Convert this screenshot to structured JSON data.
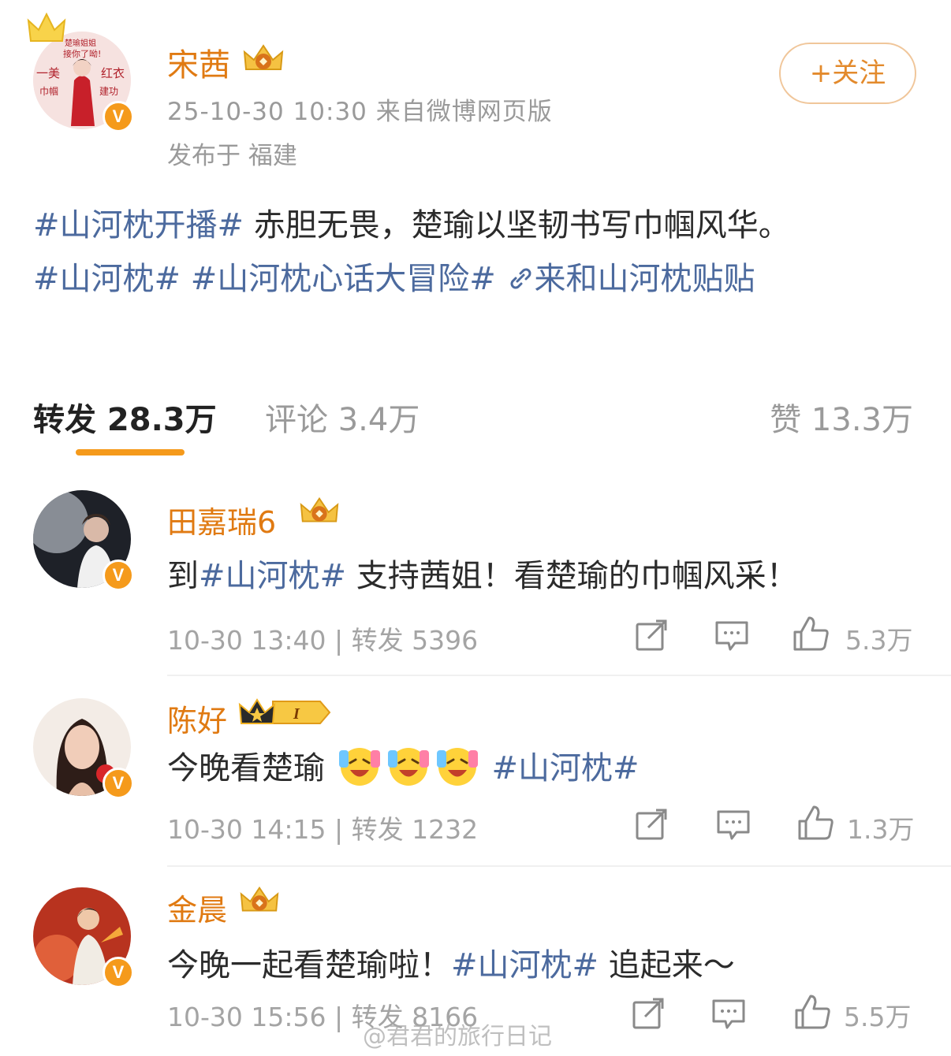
{
  "post": {
    "author": "宋茜",
    "meta": "25-10-30 10:30  来自微博网页版",
    "location": "发布于 福建",
    "follow_label": "+关注",
    "body_tag1": "#山河枕开播#",
    "body_text1": " 赤胆无畏，楚瑜以坚韧书写巾帼风华。",
    "body_tag2": "#山河枕#",
    "body_tag3": "#山河枕心话大冒险#",
    "body_link": "来和山河枕贴贴",
    "avatar_text": [
      "楚瑜姐姐",
      "接你了呦!",
      "一美",
      "红衣",
      "巾帼",
      "建功"
    ]
  },
  "tabs": {
    "repost": "转发 28.3万",
    "comment": "评论 3.4万",
    "like": "赞 13.3万"
  },
  "reposts": [
    {
      "name": "田嘉瑞6",
      "text_pre": "到",
      "tag": "#山河枕#",
      "text_post": " 支持茜姐！看楚瑜的巾帼风采！",
      "time": "10-30 13:40",
      "repost_count": "转发 5396",
      "likes": "5.3万"
    },
    {
      "name": "陈好",
      "text_pre": "今晚看楚瑜",
      "tag": "#山河枕#",
      "time": "10-30 14:15",
      "repost_count": "转发 1232",
      "likes": "1.3万",
      "badge": "I"
    },
    {
      "name": "金晨",
      "text_pre": "今晚一起看楚瑜啦！",
      "tag": "#山河枕#",
      "text_post": " 追起来～",
      "time": "10-30 15:56",
      "repost_count": "转发 8166",
      "likes": "5.5万"
    }
  ],
  "watermark": "@君君的旅行日记",
  "colors": {
    "accent": "#f59a1b",
    "name": "#e07a12",
    "link": "#4c6a9e",
    "muted": "#9a9a9a"
  }
}
